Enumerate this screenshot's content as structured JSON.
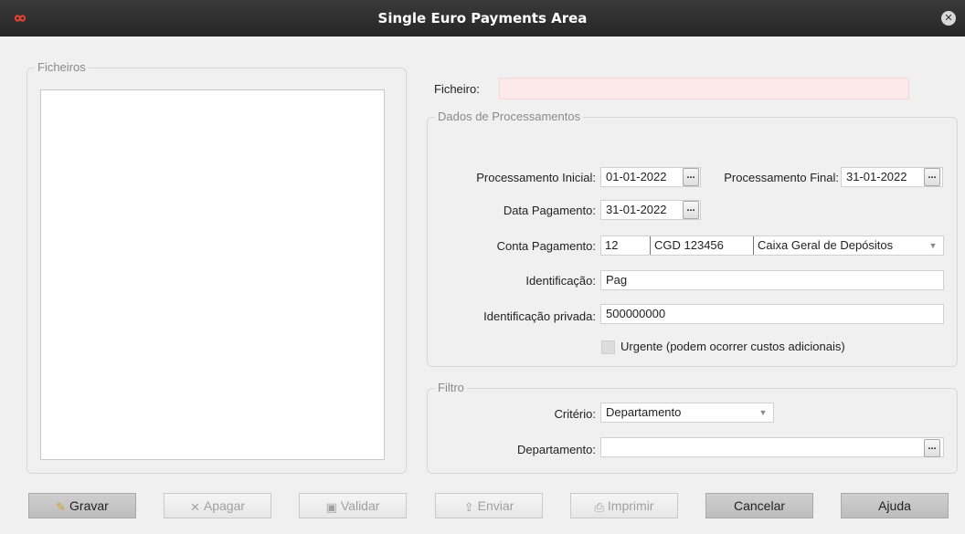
{
  "window": {
    "title": "Single Euro Payments Area",
    "logo_icon": "infinity-logo-icon",
    "accent": "#e8432e"
  },
  "files_group": {
    "label": "Ficheiros"
  },
  "file": {
    "label": "Ficheiro:",
    "value": ""
  },
  "processing_group": {
    "label": "Dados de Processamentos"
  },
  "processing": {
    "start_label": "Processamento Inicial:",
    "start_value": "01-01-2022",
    "end_label": "Processamento Final:",
    "end_value": "31-01-2022",
    "payment_date_label": "Data Pagamento:",
    "payment_date_value": "31-01-2022",
    "account_label": "Conta Pagamento:",
    "account_code": "12",
    "account_short": "CGD 123456",
    "account_bank": "Caixa Geral de Depósitos",
    "id_label": "Identificação:",
    "id_value": "Pag",
    "private_id_label": "Identificação privada:",
    "private_id_value": "500000000",
    "urgent_label": "Urgente (podem ocorrer custos adicionais)",
    "ellipsis": "..."
  },
  "filter_group": {
    "label": "Filtro"
  },
  "filter": {
    "criteria_label": "Critério:",
    "criteria_value": "Departamento",
    "department_label": "Departamento:",
    "department_value": ""
  },
  "buttons": {
    "save": "Gravar",
    "delete": "Apagar",
    "validate": "Validar",
    "send": "Enviar",
    "print": "Imprimir",
    "cancel": "Cancelar",
    "help": "Ajuda"
  }
}
